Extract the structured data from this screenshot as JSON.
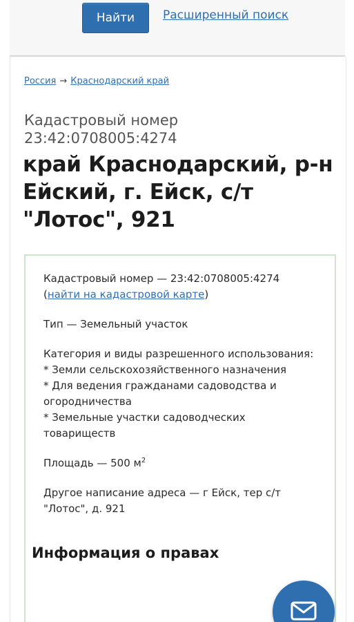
{
  "header": {
    "search_button": "Найти",
    "advanced_search": "Расширенный поиск"
  },
  "breadcrumb": {
    "items": [
      "Россия",
      "Краснодарский край"
    ],
    "separator": "→"
  },
  "object": {
    "cadastral_label": "Кадастровый номер",
    "cadastral_number": "23:42:0708005:4274",
    "address": "край Краснодарский, р-н Ейский, г. Ейск, с/т \"Лотос\", 921"
  },
  "info": {
    "cadastral_prefix": "Кадастровый номер — 23:42:0708005:4274 (",
    "map_link": "найти на кадастровой карте",
    "cadastral_suffix": ")",
    "type_line": "Тип — Земельный участок",
    "category_title": "Категория и виды разрешенного использования:",
    "category_items": [
      "* Земли сельскохозяйственного назначения",
      "* Для ведения гражданами садоводства и огородничества",
      "* Земельные участки садоводческих товариществ"
    ],
    "area_text": "Площадь — 500 м",
    "area_unit_power": "2",
    "alt_address": "Другое написание адреса — г Ейск, тер с/т \"Лотос\", д. 921"
  },
  "rights": {
    "heading": "Информация о правах"
  },
  "icons": {
    "mail": "mail-icon"
  },
  "colors": {
    "accent": "#2f6fb0",
    "box_border": "#cfe3cf"
  }
}
